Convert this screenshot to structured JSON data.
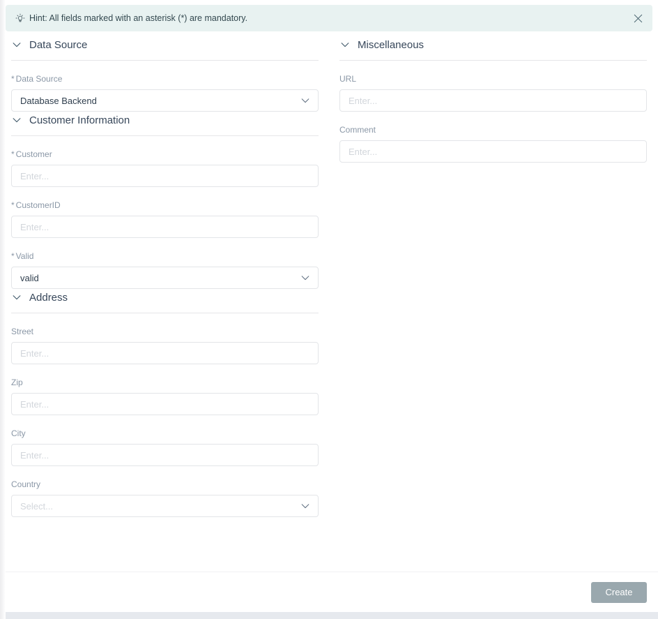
{
  "hint": {
    "icon": "lightbulb-icon",
    "text": "Hint: All fields marked with an asterisk (*) are mandatory.",
    "close_icon": "close-icon"
  },
  "colors": {
    "hint_background": "#e8f2f1",
    "hint_text": "#33484f",
    "section_title": "#37475a",
    "label": "#8a97a6",
    "value": "#2f3e4d",
    "placeholder": "#d2d6db",
    "border": "#e3e5e8",
    "button_disabled": "#9aa8ae",
    "button_text": "#ffffff",
    "bottom_strip": "#e6e9ee"
  },
  "left_column": {
    "sections": [
      {
        "title": "Data Source",
        "chevron_icon": "chevron-down-icon",
        "fields": [
          {
            "name": "data-source",
            "label": "Data Source",
            "required": true,
            "type": "select",
            "value": "Database Backend",
            "placeholder": "",
            "chevron_icon": "chevron-down-icon"
          }
        ]
      },
      {
        "title": "Customer Information",
        "chevron_icon": "chevron-down-icon",
        "fields": [
          {
            "name": "customer",
            "label": "Customer",
            "required": true,
            "type": "text",
            "value": "",
            "placeholder": "Enter..."
          },
          {
            "name": "customer-id",
            "label": "CustomerID",
            "required": true,
            "type": "text",
            "value": "",
            "placeholder": "Enter..."
          },
          {
            "name": "valid",
            "label": "Valid",
            "required": true,
            "type": "select",
            "value": "valid",
            "placeholder": "",
            "chevron_icon": "chevron-down-icon"
          }
        ]
      },
      {
        "title": "Address",
        "chevron_icon": "chevron-down-icon",
        "fields": [
          {
            "name": "street",
            "label": "Street",
            "required": false,
            "type": "text",
            "value": "",
            "placeholder": "Enter..."
          },
          {
            "name": "zip",
            "label": "Zip",
            "required": false,
            "type": "text",
            "value": "",
            "placeholder": "Enter..."
          },
          {
            "name": "city",
            "label": "City",
            "required": false,
            "type": "text",
            "value": "",
            "placeholder": "Enter..."
          },
          {
            "name": "country",
            "label": "Country",
            "required": false,
            "type": "select",
            "value": "",
            "placeholder": "Select...",
            "chevron_icon": "chevron-down-icon"
          }
        ]
      }
    ]
  },
  "right_column": {
    "sections": [
      {
        "title": "Miscellaneous",
        "chevron_icon": "chevron-down-icon",
        "fields": [
          {
            "name": "url",
            "label": "URL",
            "required": false,
            "type": "text",
            "value": "",
            "placeholder": "Enter..."
          },
          {
            "name": "comment",
            "label": "Comment",
            "required": false,
            "type": "text",
            "value": "",
            "placeholder": "Enter..."
          }
        ]
      }
    ]
  },
  "footer": {
    "create_label": "Create"
  }
}
